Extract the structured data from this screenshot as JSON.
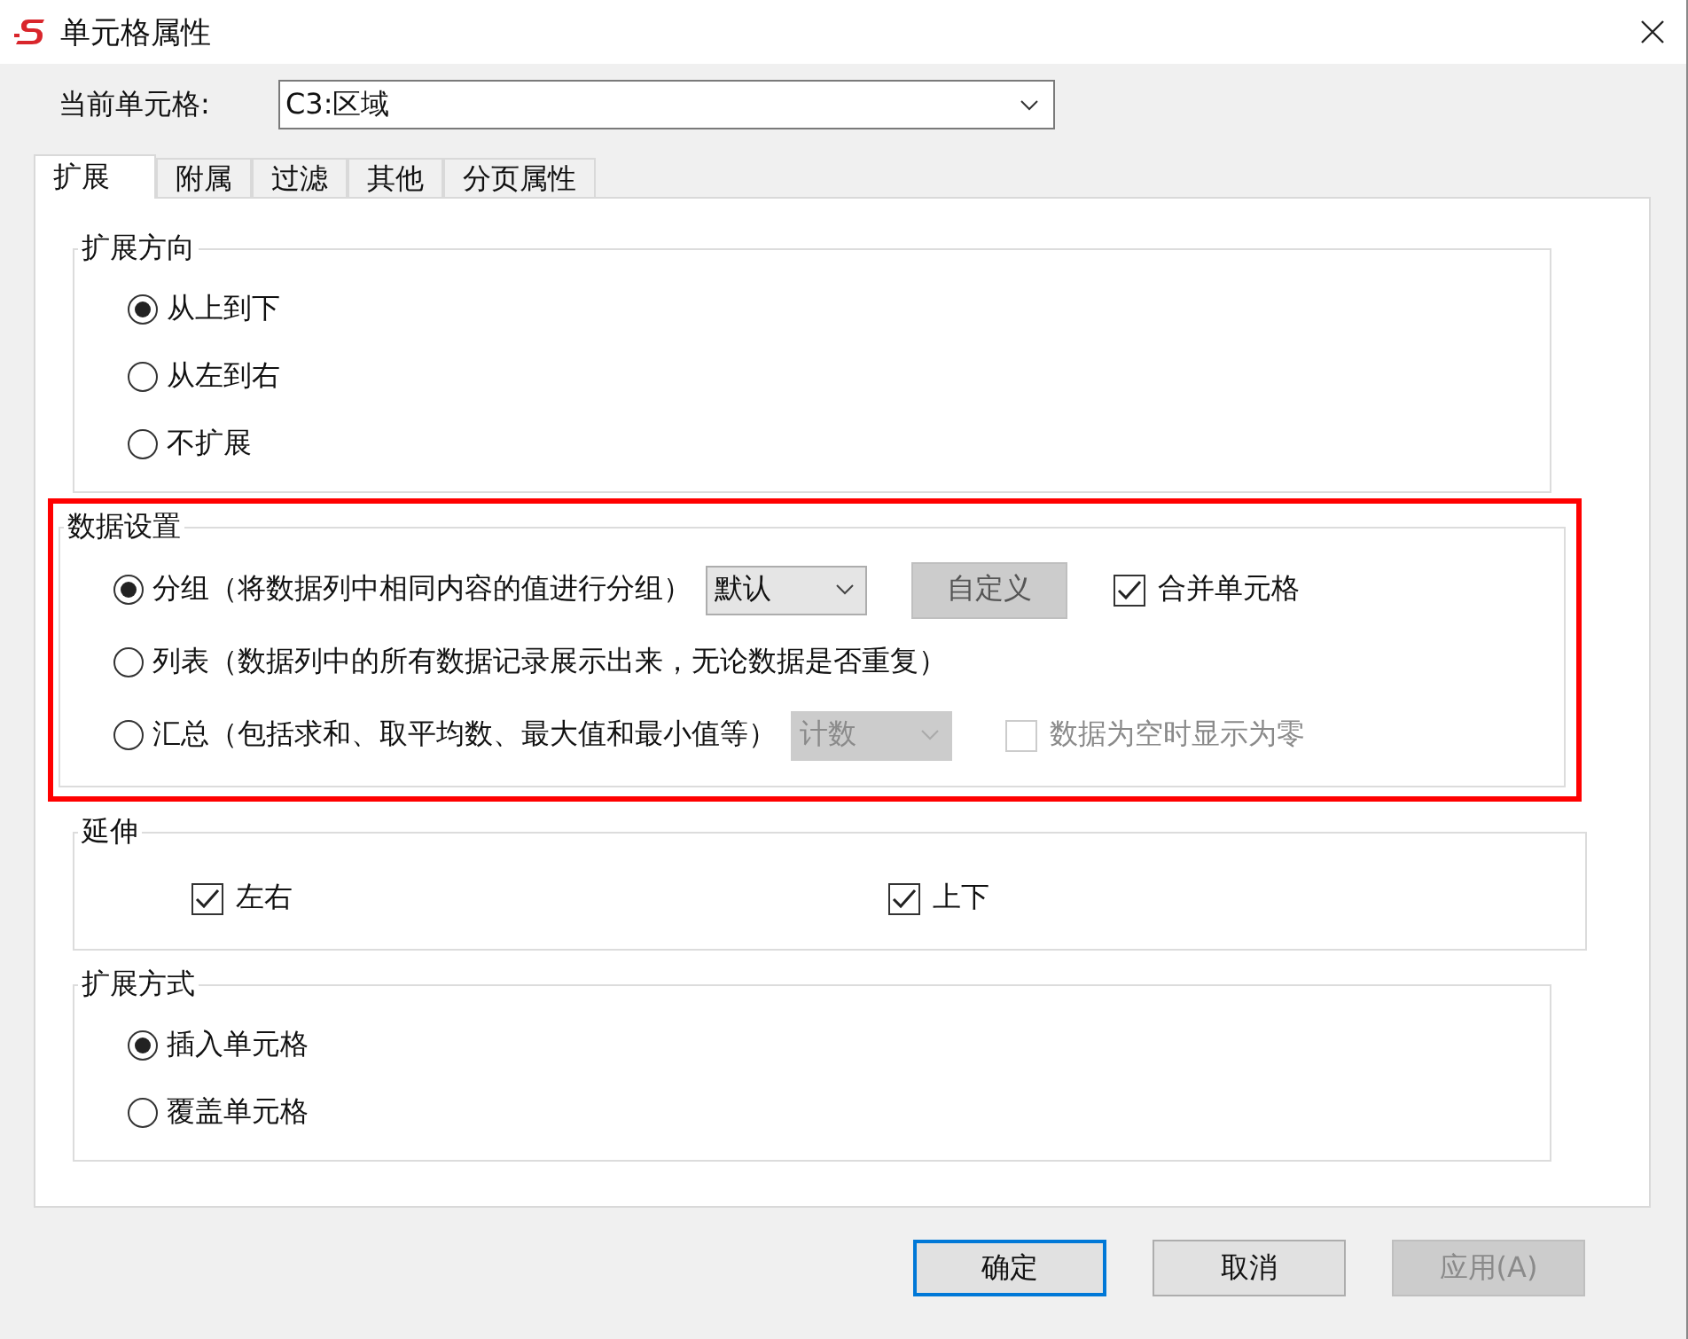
{
  "window": {
    "title": "单元格属性"
  },
  "current_cell": {
    "label": "当前单元格:",
    "value": "C3:区域"
  },
  "tabs": [
    {
      "label": "扩展",
      "selected": true
    },
    {
      "label": "附属",
      "selected": false
    },
    {
      "label": "过滤",
      "selected": false
    },
    {
      "label": "其他",
      "selected": false
    },
    {
      "label": "分页属性",
      "selected": false
    }
  ],
  "groups": [
    {
      "title": "扩展方向",
      "kind": "radios",
      "highlighted": false,
      "options": [
        {
          "label": "从上到下",
          "selected": true
        },
        {
          "label": "从左到右",
          "selected": false
        },
        {
          "label": "不扩展",
          "selected": false
        }
      ]
    },
    {
      "title": "数据设置",
      "kind": "radios",
      "highlighted": true,
      "options": [
        {
          "label": "分组（将数据列中相同内容的值进行分组）",
          "selected": true,
          "dropdown": {
            "value": "默认",
            "disabled": false
          },
          "button": {
            "label": "自定义"
          },
          "checkbox": {
            "label": "合并单元格",
            "checked": true,
            "disabled": false
          }
        },
        {
          "label": "列表（数据列中的所有数据记录展示出来，无论数据是否重复）",
          "selected": false
        },
        {
          "label": "汇总（包括求和、取平均数、最大值和最小值等）",
          "selected": false,
          "dropdown": {
            "value": "计数",
            "disabled": true
          },
          "checkbox": {
            "label": "数据为空时显示为零",
            "checked": false,
            "disabled": true
          }
        }
      ]
    },
    {
      "title": "延伸",
      "kind": "checks",
      "highlighted": false,
      "options": [
        {
          "label": "左右",
          "checked": true
        },
        {
          "label": "上下",
          "checked": true
        }
      ]
    },
    {
      "title": "扩展方式",
      "kind": "radios",
      "highlighted": false,
      "options": [
        {
          "label": "插入单元格",
          "selected": true
        },
        {
          "label": "覆盖单元格",
          "selected": false
        }
      ]
    }
  ],
  "buttons": [
    {
      "label": "确定",
      "default": true,
      "disabled": false
    },
    {
      "label": "取消",
      "default": false,
      "disabled": false
    },
    {
      "label": "应用(A)",
      "default": false,
      "disabled": true
    }
  ]
}
